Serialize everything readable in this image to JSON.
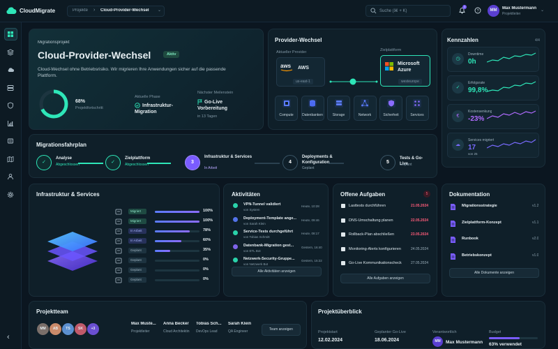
{
  "app": {
    "name": "CloudMigrate"
  },
  "header": {
    "breadcrumb_parent": "Projekte",
    "breadcrumb_sep": "›",
    "breadcrumb_current": "Cloud-Provider-Wechsel",
    "search_placeholder": "Suche (⌘ + K)",
    "notif_count": "3",
    "user_initials": "MM",
    "user_name": "Max Mustermann",
    "user_role": "Projektleiter"
  },
  "sidebar": {
    "items": [
      "grid",
      "layers",
      "cloud-upload",
      "server",
      "shield",
      "chart",
      "document",
      "map",
      "users",
      "settings"
    ],
    "collapse": "‹"
  },
  "project": {
    "label": "Migrationsprojekt",
    "title": "Cloud-Provider-Wechsel",
    "status": "Aktiv",
    "description": "Cloud-Wechsel ohne Betriebsrisiko. Wir migrieren Ihre Anwendungen sicher auf die passende Plattform.",
    "progress_value": "68%",
    "progress_label": "Projektfortschritt",
    "progress": 0.68,
    "phase_label": "Aktuelle Phase",
    "phase_value": "Infrastruktur-Migration",
    "milestone_label": "Nächster Meilenstein",
    "milestone_value": "Go-Live Vorbereitung",
    "milestone_days": "in 13 Tagen"
  },
  "provider": {
    "title": "Provider-Wechsel",
    "current_label": "Aktueller Provider",
    "current_name": "AWS",
    "current_logo": "aws",
    "current_region": "us-east-1",
    "target_label": "Zielplattform",
    "target_name": "Microsoft Azure",
    "target_region": "westeurope",
    "services": [
      "Compute",
      "Datenbanken",
      "Storage",
      "Network",
      "Sicherheit",
      "Services"
    ]
  },
  "kpi": {
    "title": "Kennzahlen",
    "page": "4/4",
    "items": [
      {
        "label": "Downtime",
        "value": "0h",
        "sub": "",
        "color": "#2ee6b8"
      },
      {
        "label": "Erfolgsrate",
        "value": "99,8%",
        "sub": "",
        "color": "#2ee6b8"
      },
      {
        "label": "Kostensenkung",
        "value": "-23%",
        "sub": "",
        "color": "#b06bff"
      },
      {
        "label": "Services migriert",
        "value": "17",
        "sub": "von 25",
        "color": "#7a6bff"
      }
    ]
  },
  "plan": {
    "title": "Migrationsfahrplan",
    "steps": [
      {
        "name": "Analyse",
        "status": "Abgeschlossen",
        "mark": "✓"
      },
      {
        "name": "Zielplattform",
        "status": "Abgeschlossen",
        "mark": "✓"
      },
      {
        "name": "Infrastruktur & Services",
        "status": "In Arbeit",
        "mark": "3"
      },
      {
        "name": "Deployments & Konfiguration",
        "status": "Geplant",
        "mark": "4"
      },
      {
        "name": "Tests & Go-Live",
        "status": "Geplant",
        "mark": "5"
      }
    ]
  },
  "infra": {
    "title": "Infrastruktur & Services",
    "rows": [
      {
        "status": "Migriert",
        "pct": "100%",
        "value": 1.0
      },
      {
        "status": "Migriert",
        "pct": "100%",
        "value": 1.0
      },
      {
        "status": "In Arbeit",
        "pct": "78%",
        "value": 0.78
      },
      {
        "status": "In Arbeit",
        "pct": "60%",
        "value": 0.6
      },
      {
        "status": "Geplant",
        "pct": "35%",
        "value": 0.35
      },
      {
        "status": "Geplant",
        "pct": "0%",
        "value": 0
      },
      {
        "status": "Geplant",
        "pct": "0%",
        "value": 0
      },
      {
        "status": "Geplant",
        "pct": "0%",
        "value": 0
      }
    ]
  },
  "activities": {
    "title": "Aktivitäten",
    "items": [
      {
        "title": "VPN-Tunnel validiert",
        "sub": "von System",
        "time": "Heute, 10:28"
      },
      {
        "title": "Deployment-Template ange...",
        "sub": "von Sarah Klein",
        "time": "Heute, 09:46"
      },
      {
        "title": "Service-Tests durchgeführt",
        "sub": "von Tobias Schmitt",
        "time": "Heute, 08:17"
      },
      {
        "title": "Datenbank-Migration gest...",
        "sub": "von ETL Bot",
        "time": "Gestern, 16:40"
      },
      {
        "title": "Netzwerk-Security-Gruppe...",
        "sub": "von Netzwerk Bot",
        "time": "Gestern, 15:22"
      }
    ],
    "button": "Alle Aktivitäten anzeigen"
  },
  "tasks": {
    "title": "Offene Aufgaben",
    "count": "5",
    "items": [
      {
        "title": "Lasttests durchführen",
        "date": "21.05.2024",
        "overdue": true
      },
      {
        "title": "DNS-Umschaltung planen",
        "date": "22.05.2024",
        "overdue": true
      },
      {
        "title": "Rollback-Plan abschließen",
        "date": "23.05.2024",
        "overdue": true
      },
      {
        "title": "Monitoring-Alerts konfigurieren",
        "date": "24.05.2024",
        "overdue": false
      },
      {
        "title": "Go-Live Kommunikationscheck",
        "date": "27.05.2024",
        "overdue": false
      }
    ],
    "button": "Alle Aufgaben anzeigen"
  },
  "docs": {
    "title": "Dokumentation",
    "items": [
      {
        "name": "Migrationsstrategie",
        "version": "v1.2"
      },
      {
        "name": "Zielplattform-Konzept",
        "version": "v1.1"
      },
      {
        "name": "Runbook",
        "version": "v2.0"
      },
      {
        "name": "Betriebskonzept",
        "version": "v1.0"
      }
    ],
    "button": "Alle Dokumente anzeigen"
  },
  "team": {
    "title": "Projektteam",
    "avatars": [
      "MM",
      "AB",
      "TS",
      "SK",
      "+3"
    ],
    "members": [
      {
        "name": "Max Muste...",
        "role": "Projektleiter"
      },
      {
        "name": "Anna Becker",
        "role": "Cloud Architektin"
      },
      {
        "name": "Tobias Sch...",
        "role": "DevOps Lead"
      },
      {
        "name": "Sarah Klein",
        "role": "QA Engineer"
      }
    ],
    "button": "Team anzeigen"
  },
  "overview": {
    "title": "Projektüberblick",
    "start_label": "Projektstart",
    "start_value": "12.02.2024",
    "golive_label": "Geplanter Go-Live",
    "golive_value": "18.06.2024",
    "owner_label": "Verantwortlich",
    "owner_initials": "MM",
    "owner_name": "Max Mustermann",
    "budget_label": "Budget",
    "budget_value": "63% verwendet",
    "budget": 0.63
  },
  "colors": {
    "accent": "#2ee6b8",
    "purple": "#7a5cff",
    "danger": "#ff5c7a"
  }
}
